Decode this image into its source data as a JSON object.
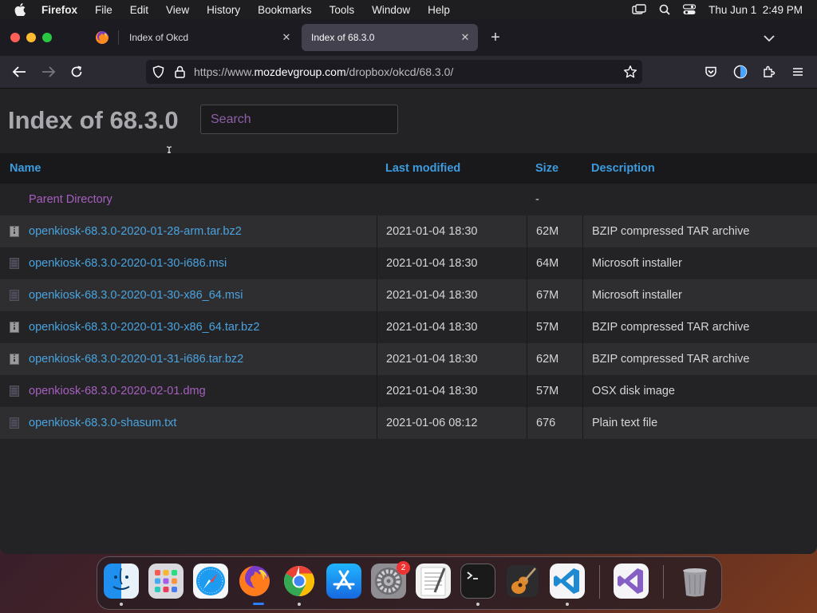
{
  "menubar": {
    "app": "Firefox",
    "items": [
      "File",
      "Edit",
      "View",
      "History",
      "Bookmarks",
      "Tools",
      "Window",
      "Help"
    ],
    "clock": "Thu Jun 1  2:49 PM"
  },
  "tabs": [
    {
      "title": "Index of Okcd"
    },
    {
      "title": "Index of 68.3.0"
    }
  ],
  "urlbar": {
    "prefix": "https://www.",
    "domain": "mozdevgroup.com",
    "path": "/dropbox/okcd/68.3.0/"
  },
  "page": {
    "title": "Index of 68.3.0",
    "search_placeholder": "Search"
  },
  "table": {
    "headers": {
      "name": "Name",
      "modified": "Last modified",
      "size": "Size",
      "description": "Description"
    },
    "parent": {
      "name": "Parent Directory",
      "size": "-"
    },
    "rows": [
      {
        "name": "openkiosk-68.3.0-2020-01-28-arm.tar.bz2",
        "modified": "2021-01-04 18:30",
        "size": "62M",
        "description": "BZIP compressed TAR archive",
        "icon": "archive-icon"
      },
      {
        "name": "openkiosk-68.3.0-2020-01-30-i686.msi",
        "modified": "2021-01-04 18:30",
        "size": "64M",
        "description": "Microsoft installer",
        "icon": "document-icon"
      },
      {
        "name": "openkiosk-68.3.0-2020-01-30-x86_64.msi",
        "modified": "2021-01-04 18:30",
        "size": "67M",
        "description": "Microsoft installer",
        "icon": "document-icon"
      },
      {
        "name": "openkiosk-68.3.0-2020-01-30-x86_64.tar.bz2",
        "modified": "2021-01-04 18:30",
        "size": "57M",
        "description": "BZIP compressed TAR archive",
        "icon": "archive-icon"
      },
      {
        "name": "openkiosk-68.3.0-2020-01-31-i686.tar.bz2",
        "modified": "2021-01-04 18:30",
        "size": "62M",
        "description": "BZIP compressed TAR archive",
        "icon": "archive-icon"
      },
      {
        "name": "openkiosk-68.3.0-2020-02-01.dmg",
        "modified": "2021-01-04 18:30",
        "size": "57M",
        "description": "OSX disk image",
        "icon": "document-icon"
      },
      {
        "name": "openkiosk-68.3.0-shasum.txt",
        "modified": "2021-01-06 08:12",
        "size": "676",
        "description": "Plain text file",
        "icon": "document-icon"
      }
    ]
  },
  "dock": {
    "apps": [
      "Finder",
      "Launchpad",
      "Safari",
      "Firefox",
      "Chrome",
      "App Store",
      "System Preferences",
      "TextEdit",
      "Terminal",
      "GarageBand",
      "Visual Studio Code",
      "Visual Studio",
      "Trash"
    ],
    "settings_badge": "2"
  },
  "colors": {
    "link": "#4aa3df",
    "visited_link": "#a65fbf",
    "header_text": "#3d9be0",
    "active_tab": "#42414d"
  }
}
